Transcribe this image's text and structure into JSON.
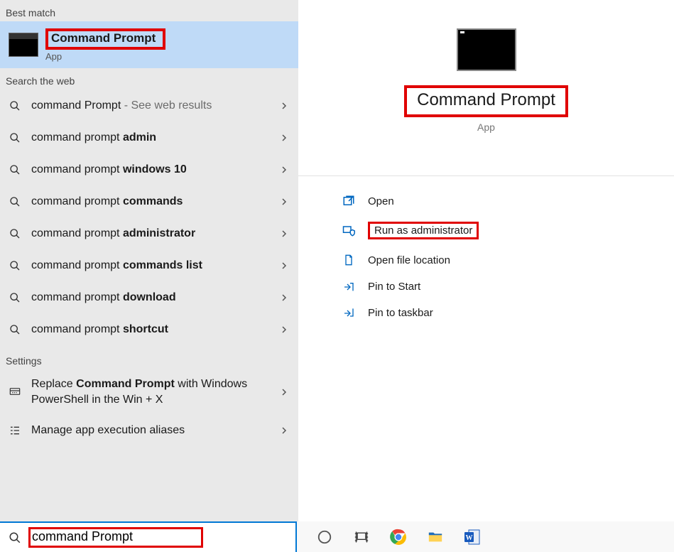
{
  "sections": {
    "best_match": "Best match",
    "search_web": "Search the web",
    "settings": "Settings"
  },
  "best_match_item": {
    "title": "Command Prompt",
    "subtitle": "App"
  },
  "web_results": [
    {
      "prefix": "command Prompt",
      "bold": "",
      "extra": " - See web results"
    },
    {
      "prefix": "command prompt ",
      "bold": "admin",
      "extra": ""
    },
    {
      "prefix": "command prompt ",
      "bold": "windows 10",
      "extra": ""
    },
    {
      "prefix": "command prompt ",
      "bold": "commands",
      "extra": ""
    },
    {
      "prefix": "command prompt ",
      "bold": "administrator",
      "extra": ""
    },
    {
      "prefix": "command prompt ",
      "bold": "commands list",
      "extra": ""
    },
    {
      "prefix": "command prompt ",
      "bold": "download",
      "extra": ""
    },
    {
      "prefix": "command prompt ",
      "bold": "shortcut",
      "extra": ""
    }
  ],
  "settings_results": [
    {
      "html": "Replace <b>Command Prompt</b> with Windows PowerShell in the Win + X"
    },
    {
      "html": "Manage app execution aliases"
    }
  ],
  "detail": {
    "title": "Command Prompt",
    "subtitle": "App",
    "actions": {
      "open": "Open",
      "run_admin": "Run as administrator",
      "open_location": "Open file location",
      "pin_start": "Pin to Start",
      "pin_taskbar": "Pin to taskbar"
    }
  },
  "search": {
    "value": "command Prompt"
  },
  "taskbar": {
    "icons": [
      "cortana",
      "task-view",
      "chrome",
      "file-explorer",
      "word"
    ]
  }
}
